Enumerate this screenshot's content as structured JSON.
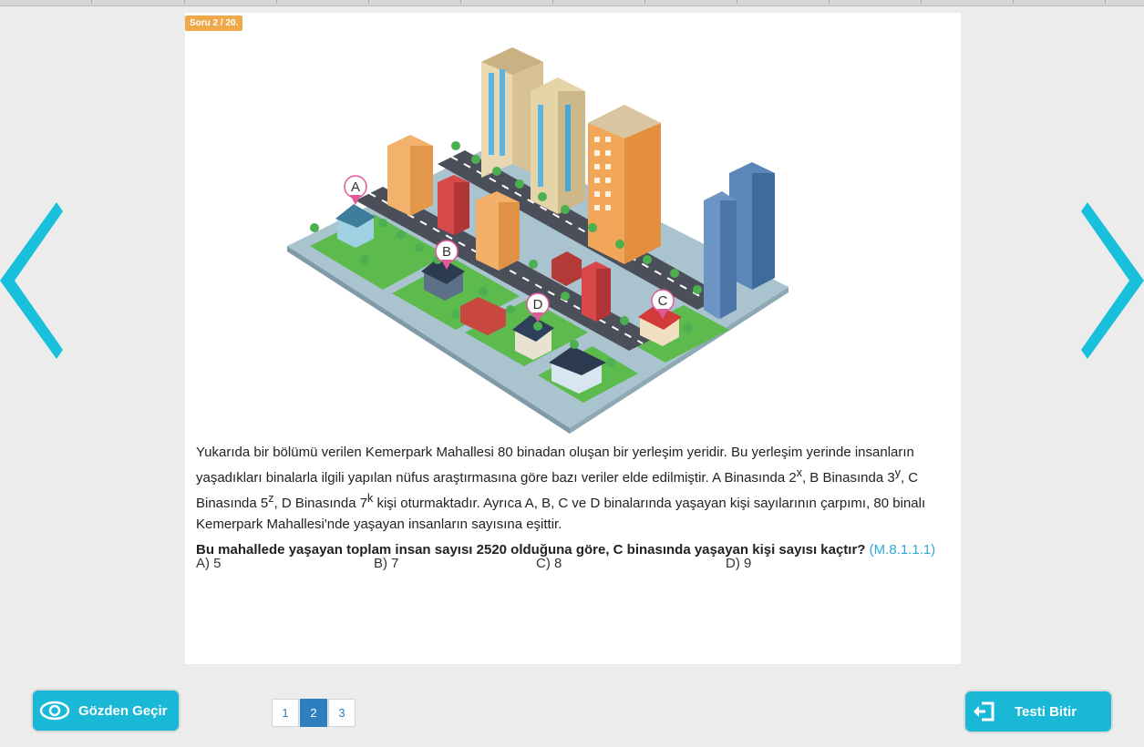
{
  "question_counter": "Soru 2 / 20.",
  "markers": {
    "a": "A",
    "b": "B",
    "c": "C",
    "d": "D"
  },
  "question": {
    "p1": "Yukarıda bir bölümü verilen Kemerpark Mahallesi 80 binadan oluşan bir yerleşim yeridir. Bu yerleşim yerinde insanların yaşadıkları binalarla ilgili yapılan nüfus araştırmasına göre bazı veriler elde edilmiştir. A Binasında ",
    "sup_x": "x",
    "p2": ", B Binasında ",
    "sup_y": "y",
    "p3": ", C Binasında ",
    "sup_z": "z",
    "p4": ", D Binasında ",
    "sup_k": "k",
    "p5": " kişi oturmaktadır. Ayrıca A, B, C ve D binalarında yaşayan kişi sayılarının çarpımı, 80 binalı Kemerpark Mahallesi'nde yaşayan insanların sayısına eşittir.",
    "base_a": "2",
    "base_b": "3",
    "base_c": "5",
    "base_d": "7",
    "bold_text": "Bu mahallede yaşayan toplam insan sayısı 2520 olduğuna göre, C binasında yaşayan kişi sayısı kaçtır?",
    "code": "(M.8.1.1.1)"
  },
  "options": [
    "A) 5",
    "B) 7",
    "C) 8",
    "D) 9"
  ],
  "buttons": {
    "review": "Gözden Geçir",
    "finish": "Testi Bitir"
  },
  "pages": [
    "1",
    "2",
    "3"
  ],
  "current_page": "2",
  "colors": {
    "accent": "#19b8d6",
    "badge": "#f0a94a",
    "page_active": "#2d7fbf",
    "code": "#2ea8d8"
  }
}
